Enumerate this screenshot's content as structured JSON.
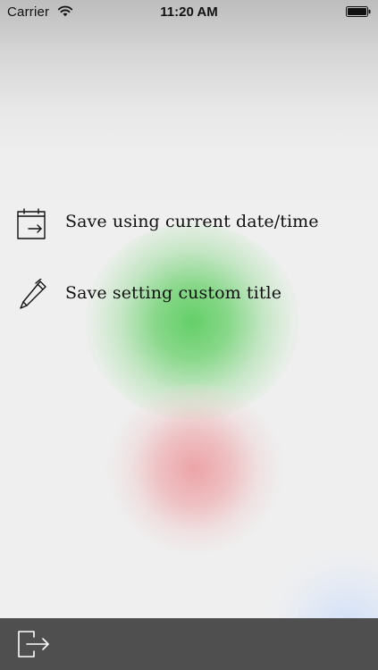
{
  "status_bar": {
    "carrier": "Carrier",
    "time": "11:20 AM",
    "icons": [
      "wifi-icon",
      "battery-icon"
    ]
  },
  "menu": {
    "items": [
      {
        "label": "Save using current date/time",
        "icon": "calendar-export-icon"
      },
      {
        "label": "Save setting custom title",
        "icon": "pen-icon"
      }
    ]
  },
  "toolbar": {
    "exit_icon": "exit-icon"
  },
  "colors": {
    "toolbar_bg": "#4f4f4f",
    "background": "#efefef",
    "green_blob": "#5ccd60",
    "red_blob": "#eca0a4",
    "blue_blob": "#cddef8"
  }
}
